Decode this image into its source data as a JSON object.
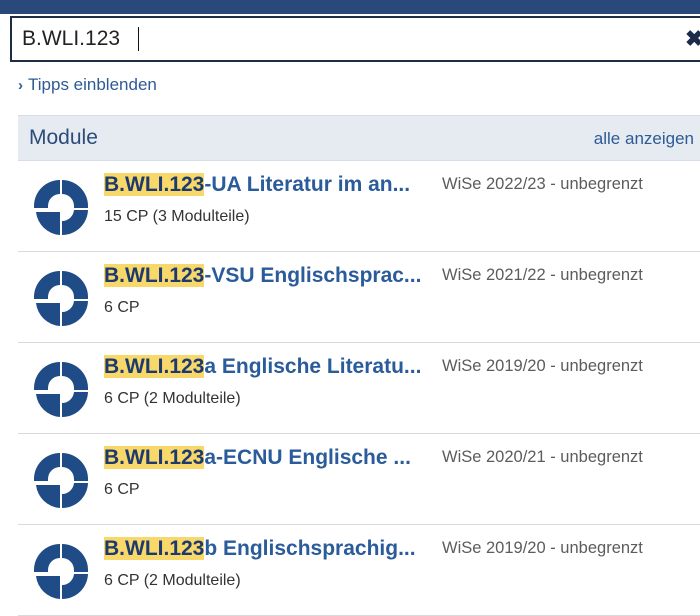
{
  "search": {
    "value": "B.WLI.123",
    "clear_icon": "close-icon"
  },
  "tips": {
    "chevron": "›",
    "label": "Tipps einblenden"
  },
  "section": {
    "title": "Module",
    "show_all": "alle anzeigen"
  },
  "colors": {
    "topbar": "#28497a",
    "link": "#2e5a95",
    "highlight": "#f8d86a",
    "section_bg": "#e6ebf2",
    "icon": "#1f4b86"
  },
  "results": [
    {
      "highlight": "B.WLI.123",
      "rest": "-UA Literatur im an...",
      "meta": "15 CP (3 Modulteile)",
      "term": "WiSe 2022/23 - unbegrenzt",
      "icon": "module-icon"
    },
    {
      "highlight": "B.WLI.123",
      "rest": "-VSU Englischsprac...",
      "meta": "6 CP",
      "term": "WiSe 2021/22 - unbegrenzt",
      "icon": "module-icon"
    },
    {
      "highlight": "B.WLI.123",
      "rest": "a Englische Literatu...",
      "meta": "6 CP (2 Modulteile)",
      "term": "WiSe 2019/20 - unbegrenzt",
      "icon": "module-icon"
    },
    {
      "highlight": "B.WLI.123",
      "rest": "a-ECNU Englische ...",
      "meta": "6 CP",
      "term": "WiSe 2020/21 - unbegrenzt",
      "icon": "module-icon"
    },
    {
      "highlight": "B.WLI.123",
      "rest": "b Englischsprachig...",
      "meta": "6 CP (2 Modulteile)",
      "term": "WiSe 2019/20 - unbegrenzt",
      "icon": "module-icon"
    }
  ]
}
